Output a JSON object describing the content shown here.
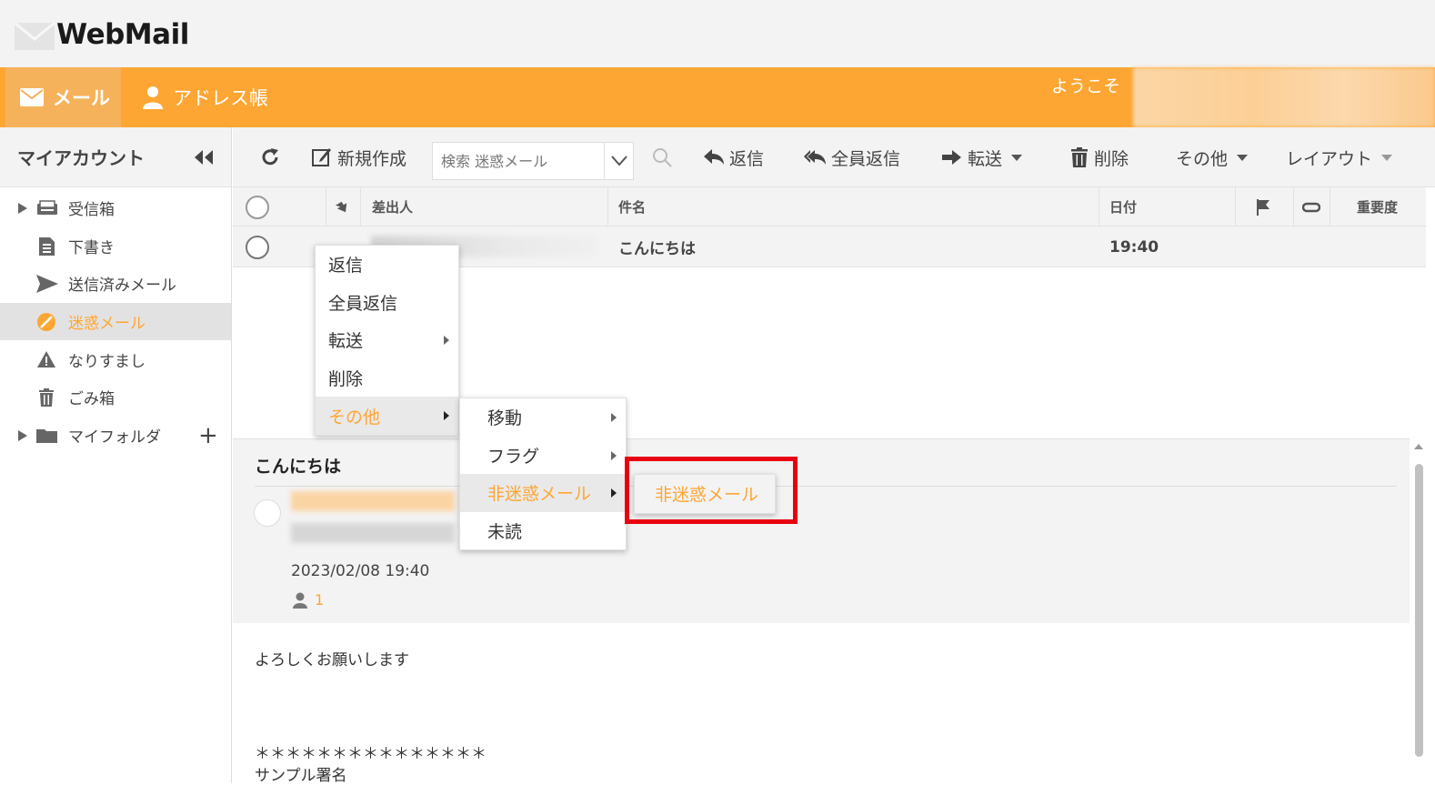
{
  "app": {
    "title": "WebMail"
  },
  "nav": {
    "mail_tab": "メール",
    "address_tab": "アドレス帳",
    "welcome": "ようこそ"
  },
  "sidebar": {
    "header": "マイアカウント",
    "folders": [
      {
        "label": "受信箱",
        "icon": "inbox-icon"
      },
      {
        "label": "下書き",
        "icon": "draft-icon"
      },
      {
        "label": "送信済みメール",
        "icon": "send-icon"
      },
      {
        "label": "迷惑メール",
        "icon": "spam-icon",
        "active": true
      },
      {
        "label": "なりすまし",
        "icon": "warning-icon"
      },
      {
        "label": "ごみ箱",
        "icon": "trash-icon"
      },
      {
        "label": "マイフォルダ",
        "icon": "folder-icon"
      }
    ],
    "add_folder": "+"
  },
  "toolbar": {
    "new": "新規作成",
    "search_placeholder": "検索 迷惑メール",
    "reply": "返信",
    "reply_all": "全員返信",
    "forward": "転送",
    "delete": "削除",
    "more": "その他",
    "layout": "レイアウト"
  },
  "list": {
    "columns": {
      "from": "差出人",
      "subject": "件名",
      "date": "日付",
      "importance": "重要度"
    },
    "rows": [
      {
        "subject": "こんにちは",
        "date": "19:40"
      }
    ]
  },
  "context_menu": {
    "items": [
      "返信",
      "全員返信",
      "転送",
      "削除",
      "その他"
    ],
    "submenu": [
      "移動",
      "フラグ",
      "非迷惑メール",
      "未読"
    ],
    "subsubmenu": [
      "非迷惑メール"
    ]
  },
  "preview": {
    "subject": "こんにちは",
    "date": "2023/02/08 19:40",
    "recipients_count": "1",
    "body": [
      "よろしくお願いします",
      "＊＊＊＊＊＊＊＊＊＊＊＊＊＊＊",
      "サンプル署名"
    ]
  },
  "colors": {
    "accent": "#fea633",
    "highlight": "#e8000e",
    "panel": "#f3f3f3"
  }
}
